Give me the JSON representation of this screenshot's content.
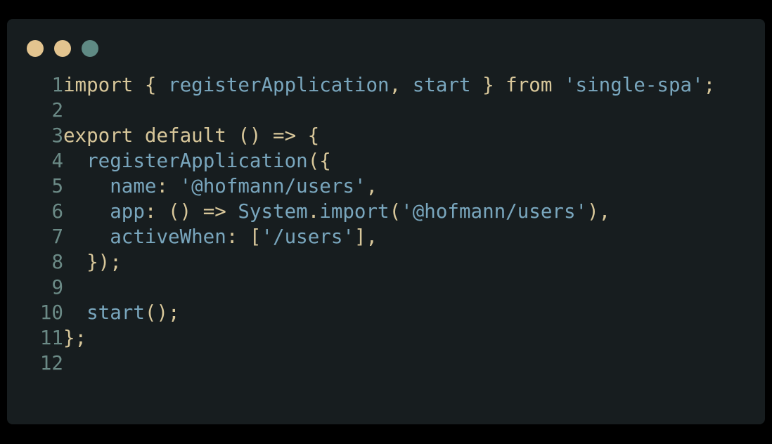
{
  "window": {
    "dots": [
      {
        "name": "close",
        "color": "#e3c48f"
      },
      {
        "name": "minimize",
        "color": "#e3c48f"
      },
      {
        "name": "zoom",
        "color": "#5f8a84"
      }
    ]
  },
  "colors": {
    "background": "#171d1f",
    "keyword": "#d8c79a",
    "identifier": "#79a6bd",
    "line_number": "#6b8a86"
  },
  "code": {
    "lines": [
      {
        "number": "1",
        "tokens": [
          {
            "text": "import { ",
            "kind": "default"
          },
          {
            "text": "registerApplication",
            "kind": "ident"
          },
          {
            "text": ", ",
            "kind": "punct"
          },
          {
            "text": "start",
            "kind": "ident"
          },
          {
            "text": " } from ",
            "kind": "default"
          },
          {
            "text": "'single-spa'",
            "kind": "string"
          },
          {
            "text": ";",
            "kind": "punct"
          }
        ]
      },
      {
        "number": "2",
        "tokens": []
      },
      {
        "number": "3",
        "tokens": [
          {
            "text": "export default () => {",
            "kind": "default"
          }
        ]
      },
      {
        "number": "4",
        "tokens": [
          {
            "text": "  ",
            "kind": "default"
          },
          {
            "text": "registerApplication",
            "kind": "ident"
          },
          {
            "text": "({",
            "kind": "punct"
          }
        ]
      },
      {
        "number": "5",
        "tokens": [
          {
            "text": "    ",
            "kind": "default"
          },
          {
            "text": "name",
            "kind": "ident"
          },
          {
            "text": ": ",
            "kind": "punct"
          },
          {
            "text": "'@hofmann/users'",
            "kind": "string"
          },
          {
            "text": ",",
            "kind": "punct"
          }
        ]
      },
      {
        "number": "6",
        "tokens": [
          {
            "text": "    ",
            "kind": "default"
          },
          {
            "text": "app",
            "kind": "ident"
          },
          {
            "text": ": () => ",
            "kind": "punct"
          },
          {
            "text": "System",
            "kind": "ident"
          },
          {
            "text": ".",
            "kind": "punct"
          },
          {
            "text": "import",
            "kind": "ident"
          },
          {
            "text": "(",
            "kind": "punct"
          },
          {
            "text": "'@hofmann/users'",
            "kind": "string"
          },
          {
            "text": "),",
            "kind": "punct"
          }
        ]
      },
      {
        "number": "7",
        "tokens": [
          {
            "text": "    ",
            "kind": "default"
          },
          {
            "text": "activeWhen",
            "kind": "ident"
          },
          {
            "text": ": [",
            "kind": "punct"
          },
          {
            "text": "'/users'",
            "kind": "string"
          },
          {
            "text": "],",
            "kind": "punct"
          }
        ]
      },
      {
        "number": "8",
        "tokens": [
          {
            "text": "  });",
            "kind": "punct"
          }
        ]
      },
      {
        "number": "9",
        "tokens": []
      },
      {
        "number": "10",
        "tokens": [
          {
            "text": "  ",
            "kind": "default"
          },
          {
            "text": "start",
            "kind": "ident"
          },
          {
            "text": "();",
            "kind": "punct"
          }
        ]
      },
      {
        "number": "11",
        "tokens": [
          {
            "text": "};",
            "kind": "punct"
          }
        ]
      },
      {
        "number": "12",
        "tokens": []
      }
    ]
  }
}
